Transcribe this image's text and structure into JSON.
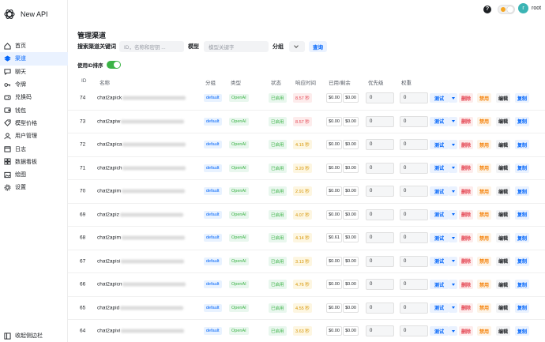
{
  "brand": {
    "name": "New API"
  },
  "nav": [
    {
      "label": "首页",
      "icon": "home-icon"
    },
    {
      "label": "渠道",
      "icon": "layers-icon",
      "active": true
    },
    {
      "label": "聊天",
      "icon": "chat-icon"
    },
    {
      "label": "令牌",
      "icon": "key-icon"
    },
    {
      "label": "兑换码",
      "icon": "ticket-icon"
    },
    {
      "label": "钱包",
      "icon": "wallet-icon"
    },
    {
      "label": "模型价格",
      "icon": "price-icon"
    },
    {
      "label": "用户管理",
      "icon": "user-icon"
    },
    {
      "label": "日志",
      "icon": "calendar-icon"
    },
    {
      "label": "数据看板",
      "icon": "dashboard-icon"
    },
    {
      "label": "绘图",
      "icon": "image-icon"
    },
    {
      "label": "设置",
      "icon": "gear-icon"
    }
  ],
  "sidebar": {
    "collapse_label": "收起侧边栏"
  },
  "header": {
    "user_name": "root",
    "avatar_letter": "r",
    "help_glyph": "?"
  },
  "page": {
    "title": "管理渠道",
    "search_label": "搜索渠道关键词",
    "search_placeholder": "ID，名称和密钥 ...",
    "model_label": "模型",
    "model_placeholder": "模型关键字",
    "group_label": "分组",
    "query_label": "查询",
    "id_sort_label": "使用ID排序"
  },
  "table": {
    "headers": {
      "id": "ID",
      "name": "名称",
      "group": "分组",
      "type": "类型",
      "status": "状态",
      "response": "响应时间",
      "balance": "已用/剩余",
      "priority": "优先级",
      "weight": "权重"
    },
    "actions": {
      "test": "测试",
      "delete": "删除",
      "disable": "禁用",
      "edit": "编辑",
      "copy": "复制"
    },
    "rows": [
      {
        "id": "74",
        "name": "chat2apick",
        "group": "default",
        "type": "OpenAI",
        "status": "已启用",
        "response": "8.57 秒",
        "resp_level": "red",
        "used": "$0.00",
        "left": "$0.00",
        "priority": "0",
        "weight": "0"
      },
      {
        "id": "73",
        "name": "chat2apiw",
        "group": "default",
        "type": "OpenAI",
        "status": "已启用",
        "response": "8.57 秒",
        "resp_level": "red",
        "used": "$0.00",
        "left": "$0.00",
        "priority": "0",
        "weight": "0"
      },
      {
        "id": "72",
        "name": "chat2apica",
        "group": "default",
        "type": "OpenAI",
        "status": "已启用",
        "response": "4.15 秒",
        "resp_level": "yel",
        "used": "$0.00",
        "left": "$0.00",
        "priority": "0",
        "weight": "0"
      },
      {
        "id": "71",
        "name": "chat2apich",
        "group": "default",
        "type": "OpenAI",
        "status": "已启用",
        "response": "3.20 秒",
        "resp_level": "yel",
        "used": "$0.00",
        "left": "$0.00",
        "priority": "0",
        "weight": "0"
      },
      {
        "id": "70",
        "name": "chat2apim",
        "group": "default",
        "type": "OpenAI",
        "status": "已启用",
        "response": "2.91 秒",
        "resp_level": "yel",
        "used": "$0.00",
        "left": "$0.00",
        "priority": "0",
        "weight": "0"
      },
      {
        "id": "69",
        "name": "chat2apiz",
        "group": "default",
        "type": "OpenAI",
        "status": "已启用",
        "response": "4.07 秒",
        "resp_level": "yel",
        "used": "$0.00",
        "left": "$0.00",
        "priority": "0",
        "weight": "0"
      },
      {
        "id": "68",
        "name": "chat2apim",
        "group": "default",
        "type": "OpenAI",
        "status": "已启用",
        "response": "4.14 秒",
        "resp_level": "yel",
        "used": "$0.61",
        "left": "$0.00",
        "priority": "0",
        "weight": "0"
      },
      {
        "id": "67",
        "name": "chat2apisi",
        "group": "default",
        "type": "OpenAI",
        "status": "已启用",
        "response": "3.13 秒",
        "resp_level": "yel",
        "used": "$0.00",
        "left": "$0.00",
        "priority": "0",
        "weight": "0"
      },
      {
        "id": "66",
        "name": "chat2apicn",
        "group": "default",
        "type": "OpenAI",
        "status": "已启用",
        "response": "4.76 秒",
        "resp_level": "yel",
        "used": "$0.00",
        "left": "$0.00",
        "priority": "0",
        "weight": "0"
      },
      {
        "id": "65",
        "name": "chat2apid",
        "group": "default",
        "type": "OpenAI",
        "status": "已启用",
        "response": "4.55 秒",
        "resp_level": "yel",
        "used": "$0.00",
        "left": "$0.00",
        "priority": "0",
        "weight": "0"
      },
      {
        "id": "64",
        "name": "chat2apivi",
        "group": "default",
        "type": "OpenAI",
        "status": "已启用",
        "response": "3.63 秒",
        "resp_level": "yel",
        "used": "$0.00",
        "left": "$0.00",
        "priority": "0",
        "weight": "0"
      }
    ]
  }
}
